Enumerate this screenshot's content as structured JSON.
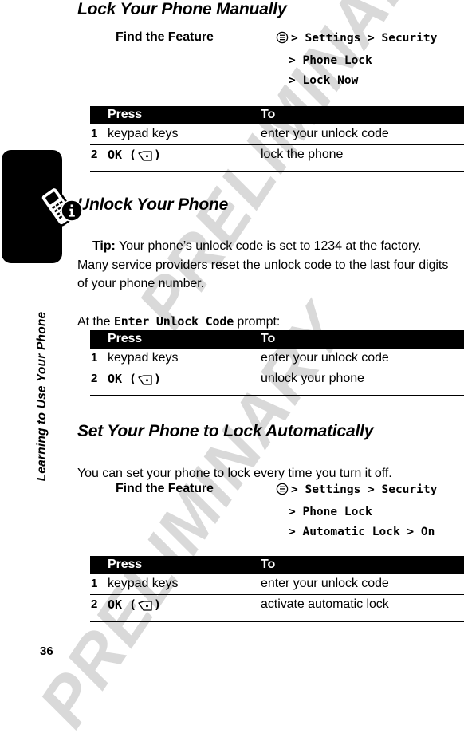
{
  "document": {
    "page_number": "36",
    "chapter_label": "Learning to Use Your Phone",
    "watermark": "PRELIMINARY",
    "watermark_color": "#d9d9d9"
  },
  "sections": [
    {
      "title": "Lock Your Phone Manually",
      "find_the_feature": {
        "label": "Find the Feature",
        "icon": "menu-icon",
        "lines": [
          "> Settings > Security",
          "> Phone Lock",
          "> Lock Now"
        ]
      },
      "table": {
        "headers": {
          "num": "",
          "press": "Press",
          "to": "To"
        },
        "rows": [
          {
            "num": "1",
            "press": "keypad keys",
            "press_icon": "",
            "to": "enter your unlock code"
          },
          {
            "num": "2",
            "press": "OK",
            "press_icon": "softkey-icon",
            "to": "lock the phone"
          }
        ]
      }
    },
    {
      "title": "Unlock Your Phone",
      "tip_label": "Tip:",
      "tip_text": " Your phone’s unlock code is set to 1234 at the factory. Many service providers reset the unlock code to the last four digits of your phone number.",
      "prompt_before": "At the ",
      "prompt_mono": "Enter Unlock Code",
      "prompt_after": " prompt:",
      "table": {
        "headers": {
          "num": "",
          "press": "Press",
          "to": "To"
        },
        "rows": [
          {
            "num": "1",
            "press": "keypad keys",
            "press_icon": "",
            "to": "enter your unlock code"
          },
          {
            "num": "2",
            "press": "OK",
            "press_icon": "softkey-icon",
            "to": "unlock your phone"
          }
        ]
      }
    },
    {
      "title": "Set Your Phone to Lock Automatically",
      "intro": "You can set your phone to lock every time you turn it off.",
      "find_the_feature": {
        "label": "Find the Feature",
        "icon": "menu-icon",
        "lines": [
          "> Settings > Security",
          "> Phone Lock",
          "> Automatic Lock > On"
        ]
      },
      "table": {
        "headers": {
          "num": "",
          "press": "Press",
          "to": "To"
        },
        "rows": [
          {
            "num": "1",
            "press": "keypad keys",
            "press_icon": "",
            "to": "enter your unlock code"
          },
          {
            "num": "2",
            "press": "OK",
            "press_icon": "softkey-icon",
            "to": "activate automatic lock"
          }
        ]
      }
    }
  ]
}
